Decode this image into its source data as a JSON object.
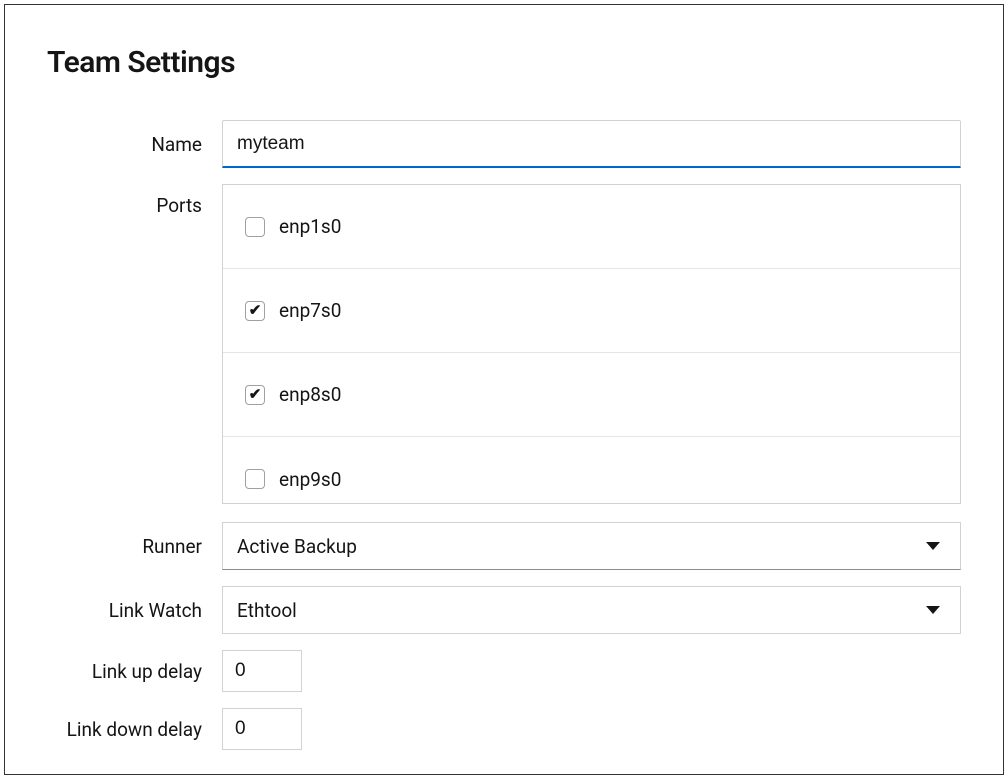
{
  "title": "Team Settings",
  "form": {
    "name_label": "Name",
    "name_value": "myteam",
    "ports_label": "Ports",
    "ports": [
      {
        "name": "enp1s0",
        "checked": false
      },
      {
        "name": "enp7s0",
        "checked": true
      },
      {
        "name": "enp8s0",
        "checked": true
      },
      {
        "name": "enp9s0",
        "checked": false
      }
    ],
    "runner_label": "Runner",
    "runner_value": "Active Backup",
    "link_watch_label": "Link Watch",
    "link_watch_value": "Ethtool",
    "link_up_delay_label": "Link up delay",
    "link_up_delay_value": "0",
    "link_down_delay_label": "Link down delay",
    "link_down_delay_value": "0"
  }
}
